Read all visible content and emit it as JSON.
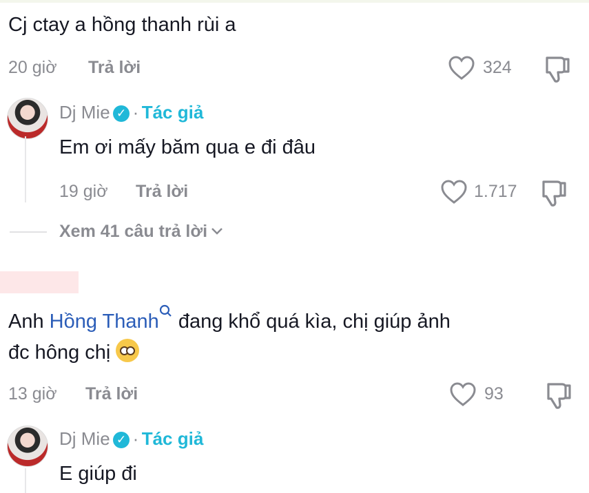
{
  "comments": [
    {
      "text": "Cj ctay a hồng thanh rùi a",
      "time": "20 giờ",
      "reply_label": "Trả lời",
      "likes": "324"
    },
    {
      "author": "Dj Mie",
      "author_tag": "Tác giả",
      "separator": "·",
      "text": "Em ơi mấy băm qua e đi đâu",
      "time": "19 giờ",
      "reply_label": "Trả lời",
      "likes": "1.717",
      "view_replies": "Xem 41 câu trả lời"
    },
    {
      "text_prefix": "Anh ",
      "mention": "Hồng Thanh",
      "text_suffix": " đang khổ quá kìa, chị giúp ảnh",
      "text_line2": "đc hông chị",
      "time": "13 giờ",
      "reply_label": "Trả lời",
      "likes": "93"
    },
    {
      "author": "Dj Mie",
      "author_tag": "Tác giả",
      "separator": "·",
      "text": "E giúp đi"
    }
  ],
  "icons": {
    "like": "heart-outline-icon",
    "dislike": "thumbs-down-outline-icon",
    "verified": "verified-check-icon",
    "chevron": "chevron-down-icon",
    "search": "search-icon",
    "emoji": "pleading-face-emoji"
  },
  "colors": {
    "text": "#161823",
    "muted": "#8a8b91",
    "author_tag": "#20b8d8",
    "mention": "#2b5db8"
  }
}
